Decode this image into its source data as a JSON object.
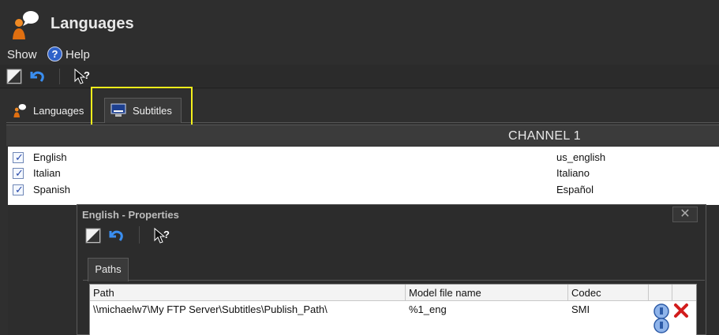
{
  "app": {
    "title": "Languages"
  },
  "menu": {
    "show": "Show",
    "help": "Help"
  },
  "tabs": [
    {
      "label": "Languages"
    },
    {
      "label": "Subtitles"
    }
  ],
  "channel": {
    "title": "CHANNEL 1"
  },
  "languages": [
    {
      "name": "English",
      "code": "us_english",
      "checked": true
    },
    {
      "name": "Italian",
      "code": "Italiano",
      "checked": true
    },
    {
      "name": "Spanish",
      "code": "Español",
      "checked": true
    }
  ],
  "dialog": {
    "title": "English - Properties",
    "close": "✕",
    "tab": "Paths",
    "columns": {
      "path": "Path",
      "model": "Model file name",
      "codec": "Codec"
    },
    "rows": [
      {
        "path": "\\\\michaelw7\\My FTP Server\\Subtitles\\Publish_Path\\",
        "model": "%1_eng",
        "codec": "SMI"
      }
    ]
  },
  "icons": {
    "app": "languages-person-icon",
    "help": "help-icon",
    "save": "save-icon",
    "undo": "undo-icon",
    "whats_this": "whats-this-pointer-icon",
    "subtitles": "monitor-subtitles-icon",
    "edit": "edit-icon",
    "delete": "delete-icon"
  },
  "colors": {
    "highlight": "#f4f01b",
    "accent_blue": "#2f62c9",
    "delete_red": "#d21c1c"
  }
}
